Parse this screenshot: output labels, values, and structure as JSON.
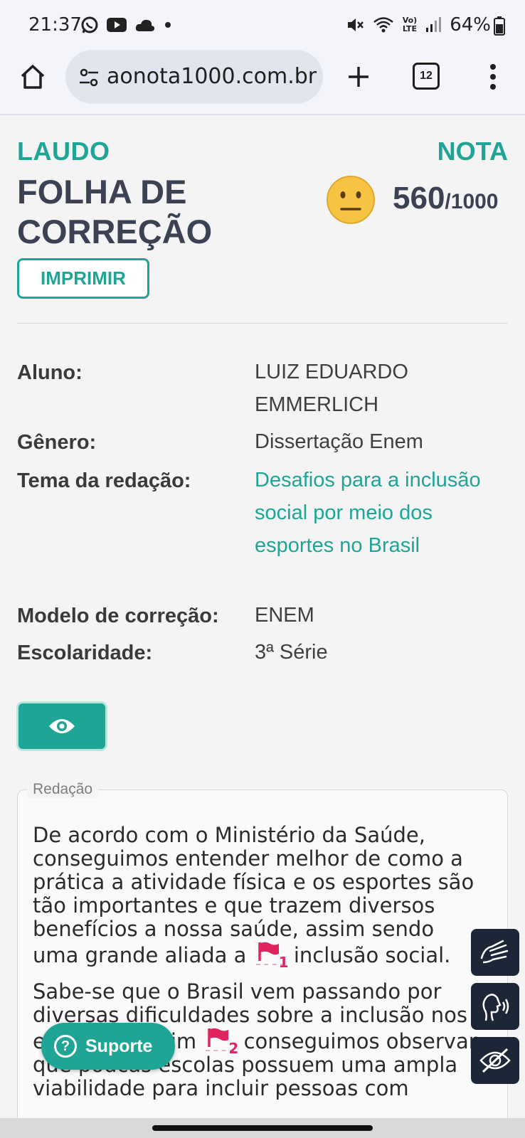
{
  "status_bar": {
    "time": "21:37",
    "battery": "64%",
    "icons_left": [
      "whatsapp-icon",
      "youtube-icon",
      "cloud-icon",
      "dot-icon"
    ],
    "icons_right": [
      "mute-icon",
      "wifi-icon",
      "volte-icon",
      "signal-icon",
      "battery-icon"
    ],
    "volte_top": "Vo)",
    "volte_bottom": "LTE"
  },
  "browser": {
    "url": "aonota1000.com.br",
    "tab_count": "12"
  },
  "header": {
    "laudo": "LAUDO",
    "title": "FOLHA DE CORREÇÃO",
    "print_label": "IMPRIMIR",
    "nota_label": "NOTA",
    "score": "560",
    "score_total": "/1000"
  },
  "info": {
    "aluno_label": "Aluno:",
    "aluno_value": "LUIZ EDUARDO EMMERLICH",
    "genero_label": "Gênero:",
    "genero_value": "Dissertação Enem",
    "tema_label": "Tema da redação:",
    "tema_value": "Desafios para a inclusão social por meio dos esportes no Brasil",
    "modelo_label": "Modelo de correção:",
    "modelo_value": "ENEM",
    "escolaridade_label": "Escolaridade:",
    "escolaridade_value": "3ª Série"
  },
  "redacao": {
    "legend": "Redação",
    "p1_before": "De acordo com o Ministério da Saúde, conseguimos entender melhor de como a prática a atividade física e os esportes são tão importantes e que trazem diversos benefícios a nossa saúde, assim sendo uma grande aliada a",
    "p1_flag": "1",
    "p1_after": "inclusão social.",
    "p2_before": "Sabe-se que o Brasil vem passando por diversas dificuldades sobre a inclusão nos esportes. Assim",
    "p2_flag": "2",
    "p2_after": "conseguimos observar que poucas escolas possuem uma ampla viabilidade para incluir pessoas com"
  },
  "support": {
    "label": "Suporte"
  },
  "colors": {
    "accent": "#1fa596",
    "heading": "#3c4253",
    "flag": "#e0245e",
    "a11y_bg": "#1d2636"
  }
}
